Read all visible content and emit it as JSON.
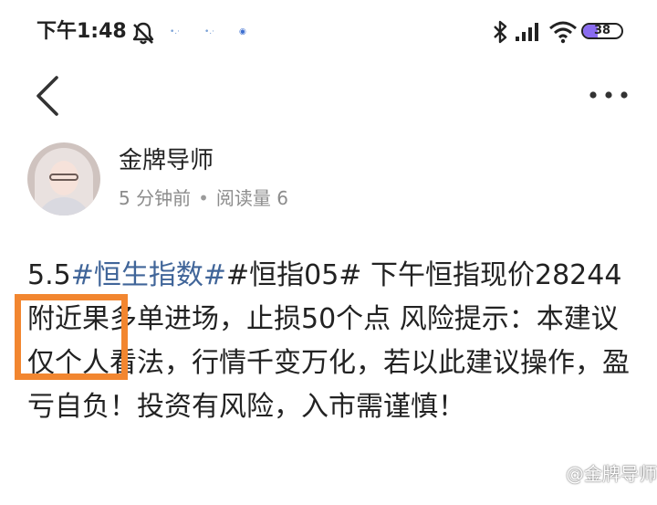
{
  "status_bar": {
    "time": "下午1:48",
    "battery_level": "38",
    "battery_fraction": 0.38,
    "icons": [
      "mute-icon",
      "notification-dot-icon",
      "bluetooth-icon",
      "signal-icon",
      "wifi-icon",
      "battery-icon"
    ]
  },
  "nav": {
    "back_icon": "chevron-left-icon",
    "more_icon": "more-horizontal-icon"
  },
  "author": {
    "name": "金牌导师",
    "time_ago": "5 分钟前",
    "separator": "•",
    "reads": "阅读量 6"
  },
  "post": {
    "prefix": "5.5",
    "hashtag": "#恒生指数#",
    "body": "#恒指05# 下午恒指现价28244附近果多单进场，止损50个点 风险提示：本建议仅个人看法，行情千变万化，若以此建议操作，盈亏自负！投资有风险，入市需谨慎！"
  },
  "watermark": {
    "text": "@金牌导师"
  },
  "colors": {
    "hashtag": "#406599",
    "highlight": "#f28630",
    "meta": "#8c8c8c",
    "battery_fill": "#8a6cf0"
  }
}
